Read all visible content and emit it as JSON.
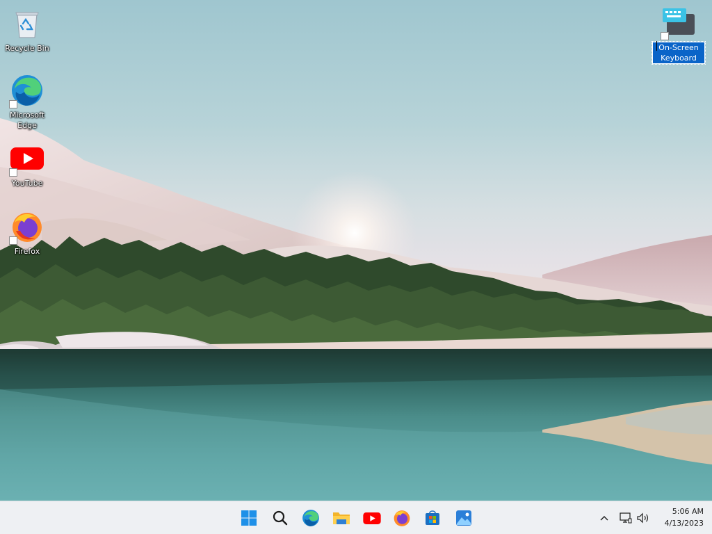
{
  "desktop": {
    "icons": [
      {
        "label": "Recycle Bin",
        "icon": "recycle-bin-icon"
      },
      {
        "label": "Microsoft Edge",
        "icon": "edge-icon"
      },
      {
        "label": "YouTube",
        "icon": "youtube-icon"
      },
      {
        "label": "Firefox",
        "icon": "firefox-icon"
      },
      {
        "label": "On-Screen Keyboard",
        "icon": "keyboard-icon",
        "selected": true
      }
    ]
  },
  "taskbar": {
    "pinned": [
      {
        "name": "start",
        "icon": "windows-start-icon"
      },
      {
        "name": "search",
        "icon": "search-icon"
      },
      {
        "name": "edge",
        "icon": "edge-icon"
      },
      {
        "name": "file-explorer",
        "icon": "folder-icon"
      },
      {
        "name": "youtube",
        "icon": "youtube-icon"
      },
      {
        "name": "firefox",
        "icon": "firefox-icon"
      },
      {
        "name": "microsoft-store",
        "icon": "store-icon"
      },
      {
        "name": "photos",
        "icon": "photos-icon"
      }
    ],
    "tray": {
      "icons": [
        "chevron-up-icon",
        "network-icon",
        "volume-icon"
      ],
      "time": "5:06 AM",
      "date": "4/13/2023"
    }
  },
  "colors": {
    "taskbar_bg": "#eef0f3",
    "selection": "#0a64c8",
    "windows_blue": "#1e90e8"
  }
}
